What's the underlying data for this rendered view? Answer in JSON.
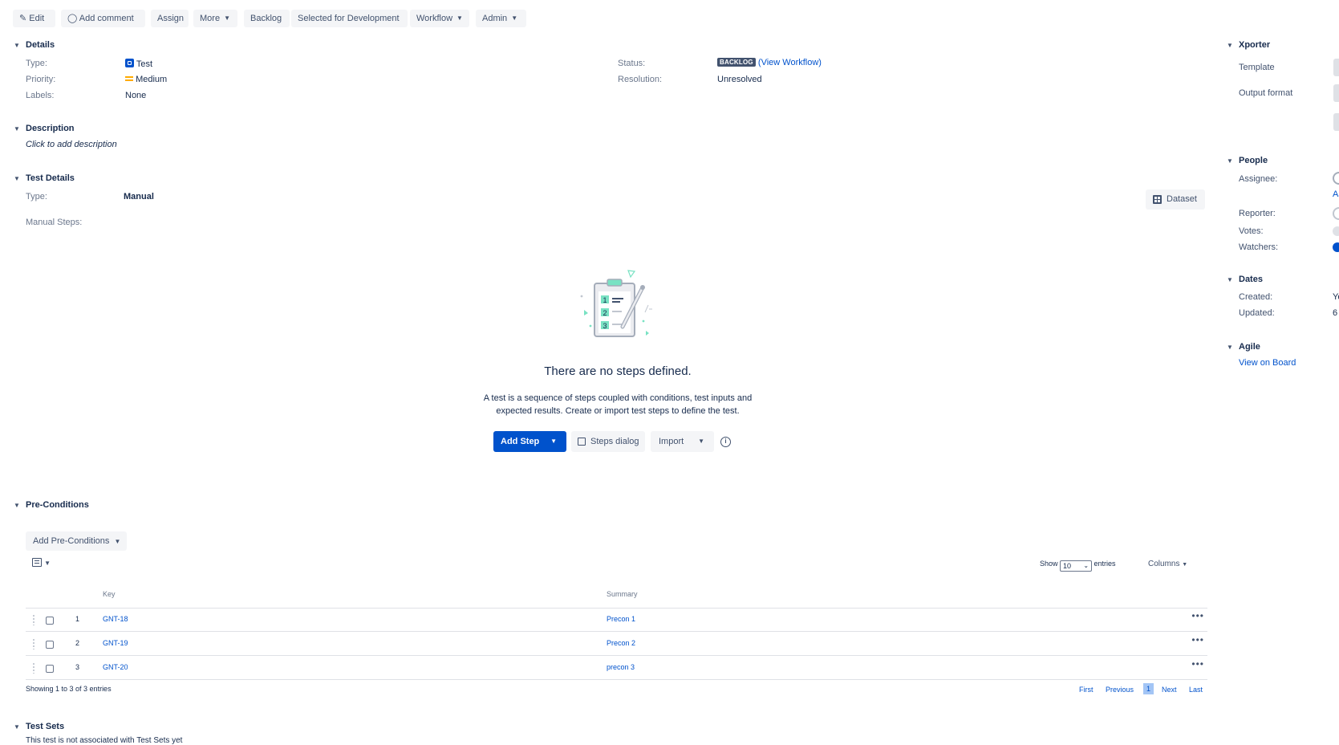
{
  "toolbar": {
    "edit": "Edit",
    "add_comment": "Add comment",
    "assign": "Assign",
    "more": "More",
    "backlog": "Backlog",
    "selected_for_dev": "Selected for Development",
    "workflow": "Workflow",
    "admin": "Admin"
  },
  "details": {
    "header": "Details",
    "type_label": "Type:",
    "type_value": "Test",
    "priority_label": "Priority:",
    "priority_value": "Medium",
    "labels_label": "Labels:",
    "labels_value": "None",
    "status_label": "Status:",
    "status_value": "BACKLOG",
    "view_workflow": "(View Workflow)",
    "resolution_label": "Resolution:",
    "resolution_value": "Unresolved"
  },
  "description": {
    "header": "Description",
    "placeholder": "Click to add description"
  },
  "test_details": {
    "header": "Test Details",
    "type_label": "Type:",
    "type_value": "Manual",
    "manual_steps_label": "Manual Steps:",
    "dataset_button": "Dataset",
    "empty_title": "There are no steps defined.",
    "empty_desc_line1": "A test is a sequence of steps coupled with conditions, test inputs and",
    "empty_desc_line2": "expected results. Create or import test steps to define the test.",
    "add_step": "Add Step",
    "steps_dialog": "Steps dialog",
    "import": "Import",
    "illustration_numbers": [
      "1",
      "2",
      "3"
    ]
  },
  "preconditions": {
    "header": "Pre-Conditions",
    "add_button": "Add Pre-Conditions",
    "show_label": "Show",
    "entries_count": "10",
    "entries_label": "entries",
    "columns_button": "Columns",
    "columns": [
      "Key",
      "Summary"
    ],
    "rows": [
      {
        "num": "1",
        "key": "GNT-18",
        "summary": "Precon 1"
      },
      {
        "num": "2",
        "key": "GNT-19",
        "summary": "Precon 2"
      },
      {
        "num": "3",
        "key": "GNT-20",
        "summary": "precon 3"
      }
    ],
    "showing": "Showing 1 to 3 of 3 entries",
    "pager": {
      "first": "First",
      "previous": "Previous",
      "current": "1",
      "next": "Next",
      "last": "Last"
    }
  },
  "test_sets": {
    "header": "Test Sets",
    "text": "This test is not associated with Test Sets yet"
  },
  "sidebar": {
    "xporter_header": "Xporter",
    "template_label": "Template",
    "output_format_label": "Output format",
    "people_header": "People",
    "assignee_label": "Assignee:",
    "assignee_fragment": "As",
    "reporter_label": "Reporter:",
    "votes_label": "Votes:",
    "watchers_label": "Watchers:",
    "dates_header": "Dates",
    "created_label": "Created:",
    "created_fragment": "Ye",
    "updated_label": "Updated:",
    "updated_fragment": "6",
    "agile_header": "Agile",
    "view_on_board": "View on Board"
  },
  "colors": {
    "primary": "#0052cc",
    "text": "#172b4d",
    "subtle": "#6b778c",
    "button_bg": "#f4f5f7",
    "status_bg": "#42526e",
    "priority": "#ffab00"
  }
}
